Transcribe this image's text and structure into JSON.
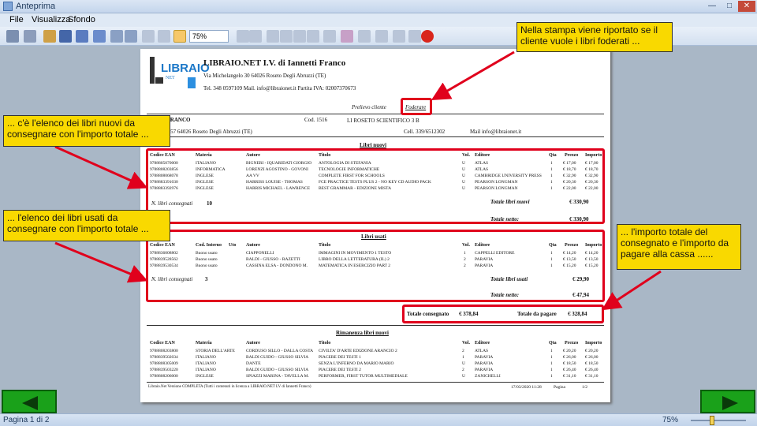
{
  "window": {
    "title": "Anteprima"
  },
  "menu": {
    "items": [
      "File",
      "Visualizza",
      "Sfondo"
    ]
  },
  "toolbar": {
    "zoom_value": "75%"
  },
  "status": {
    "page": "Pagina 1 di 2",
    "zoom": "75%",
    "zoom_level_percent": 75
  },
  "callouts": {
    "top": "Nella stampa viene riportato se il cliente vuole i libri foderati ...",
    "new_books": "... c'è l'elenco dei libri nuovi da consegnare con l'importo totale ...",
    "used_books": "... l'elenco dei libri usati da consegnare con l'importo totale ...",
    "totals": "... l'importo totale del consegnato e l'importo da pagare alla cassa ......"
  },
  "document": {
    "company": "LIBRAIO.NET I.V. di Iannetti Franco",
    "address": "Via Michelangelo 30 64026 Roseto Degli Abruzzi (TE)",
    "contacts": "Tel. 348 0597109 Mail. info@libraionet.it Partita IVA: 02007370673",
    "logo_text": "LIBRAIO",
    "logo_sub": "NET",
    "label_prelievo": "Prelievo cliente",
    "label_foderare": "Foderare",
    "client_name": "NETTI FRANCO",
    "client_address": "Garibaldi 57 64026 Roseto Degli Abruzzi (TE)",
    "cod_label": "Cod. 1516",
    "school": "LI ROSETO SCIENTIFICO   3 B",
    "cell": "Cell. 339/6512302",
    "client_mail": "Mail info@libraionet.it",
    "section_new": "Libri nuovi",
    "section_used": "Libri usati",
    "section_remaining": "Rimanenza libri nuovi",
    "col_headers": [
      "Codice EAN",
      "Materia",
      "Autore",
      "Titolo",
      "Vol.",
      "Editore",
      "Qta",
      "Prezzo",
      "Importo"
    ],
    "new_rows": [
      [
        "9788805070000",
        "ITALIANO",
        "BIGNERI - IQUARIDATI GIORGIO",
        "ANTOLOGIA DI STEFANIA",
        "U",
        "ATLAS",
        "1",
        "€ 17,00",
        "€ 17,00"
      ],
      [
        "9788808203856",
        "INFORMATICA",
        "LORENZI AGOSTINO - GOVONI",
        "TECNOLOGIE INFORMATICHE",
        "U",
        "ATLAS",
        "1",
        "€ 18,70",
        "€ 18,70"
      ],
      [
        "9788808068078",
        "INGLESE",
        "AA VV",
        "COMPLETE FIRST FOR SCHOOLS",
        "U",
        "CAMBRIDGE UNIVERSITY PRESS",
        "1",
        "€ 32,90",
        "€ 32,90"
      ],
      [
        "9788883391030",
        "INGLESE",
        "HARRISS LOUISE - THOMAS",
        "FCE PRACTICE TESTS PLUS 2 - NO KEY CD AUDIO PACK",
        "U",
        "PEARSON LONGMAN",
        "1",
        "€ 20,30",
        "€ 20,30"
      ],
      [
        "9788883392976",
        "INGLESE",
        "HARRIS MICHAEL - LAWRENCE",
        "BEST GRAMMAR - EDIZIONE MISTA",
        "U",
        "PEARSON LONGMAN",
        "1",
        "€ 22,00",
        "€ 22,00"
      ]
    ],
    "new_count_label": "N. libri consegnati",
    "new_count": "10",
    "new_total_label": "Totale libri nuovi",
    "new_total": "€ 330,90",
    "new_net_label": "Totale netto:",
    "new_net": "€ 330,90",
    "used_headers": [
      "Codice EAN",
      "Cod. Interno",
      "Uto",
      "Autore",
      "Titolo",
      "Vol.",
      "Editore",
      "Qta",
      "Prezzo",
      "Importo"
    ],
    "used_rows": [
      [
        "9788836008802",
        "Buono usato",
        "CIAPPONELLI",
        "IMMAGINI IN MOVIMENTO 1 TESTO",
        "1",
        "CAPPELLI EDITORE",
        "1",
        "€ 14,20",
        "€ 14,20"
      ],
      [
        "9788839528562",
        "Buono usato",
        "BALDI - GIUSSO - RAZETTI",
        "LIBRO DELLA LETTERATURA (IL) 2",
        "2",
        "PARAVIA",
        "1",
        "€ 13,50",
        "€ 13,50"
      ],
      [
        "9788839530534",
        "Buono usato",
        "CASSINA ELSA - DONDONO M.",
        "MATEMATICA IN ESERCIZIO PART 2",
        "2",
        "PARAVIA",
        "1",
        "€ 15,20",
        "€ 15,20"
      ]
    ],
    "used_count_label": "N. libri consegnati",
    "used_count": "3",
    "used_total_label": "Totale libri usati",
    "used_total": "€ 29,90",
    "used_net_label": "Totale netto:",
    "used_net": "€ 47,94",
    "grand_delivered_label": "Totale consegnato",
    "grand_delivered": "€ 378,84",
    "grand_pay_label": "Totale da pagare",
    "grand_pay": "€ 328,84",
    "remaining_headers": [
      "Codice EAN",
      "Materia",
      "Autore",
      "Titolo",
      "Vol.",
      "Editore",
      "Qta",
      "Prezzo",
      "Importo"
    ],
    "remaining_rows": [
      [
        "9788808203800",
        "STORIA DELL'ARTE",
        "CORDUSO SILLO - DALLA COSTA",
        "CIVILTA' D'ARTE EDIZIONE ARANCIO 2",
        "2",
        "ATLAS",
        "1",
        "€ 20,20",
        "€ 20,20"
      ],
      [
        "9788839502034",
        "ITALIANO",
        "BALDI GUIDO - GIUSSO SILVIA",
        "PIACERE DEI TESTI 1",
        "1",
        "PARAVIA",
        "1",
        "€ 26,00",
        "€ 26,00"
      ],
      [
        "9788808305009",
        "ITALIANO",
        "DANTE",
        "SENZA L'INFERNO DA MARIO MARIO",
        "U",
        "PARAVIA",
        "1",
        "€ 18,50",
        "€ 18,50"
      ],
      [
        "9788839503220",
        "ITALIANO",
        "BALDI GUIDO - GIUSSO SILVIA",
        "PIACERE DEI TESTI 2",
        "2",
        "PARAVIA",
        "1",
        "€ 26,40",
        "€ 26,40"
      ],
      [
        "9788808206000",
        "INGLESE",
        "SPIAZZI MARINA - TAVELLA M.",
        "PERFORMER, FIRST TUTOR MULTIMEDIALE",
        "U",
        "ZANICHELLI",
        "1",
        "€ 31,10",
        "€ 31,10"
      ]
    ],
    "footer_left": "Libraio.Net Versione COMPLETA (Tutti i contenuti in licenza a LIBRAIO.NET LV di Iannetti Franco)",
    "footer_date": "17/03/2020 11:28",
    "footer_page_label": "Pagina",
    "footer_page": "1/2"
  }
}
